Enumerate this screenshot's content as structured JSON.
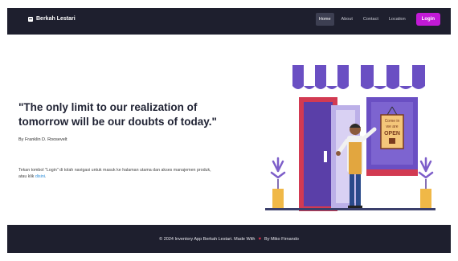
{
  "navbar": {
    "brand": "Berkah Lestari",
    "items": [
      {
        "label": "Home",
        "active": true
      },
      {
        "label": "About",
        "active": false
      },
      {
        "label": "Contact",
        "active": false
      },
      {
        "label": "Location",
        "active": false
      }
    ],
    "login_label": "Login"
  },
  "hero": {
    "quote": "\"The only limit to our realization of tomorrow will be our doubts of today.\"",
    "author": "By Franklin D. Roosevelt",
    "info_text": "Tekan tombol \"Login\" di tolah navigasi untuk masuk ke halaman utama dan akses manajemen produk, atau klik",
    "info_link": "disini",
    "info_end": ".",
    "sign_lines": [
      "Come in",
      "we are",
      "OPEN"
    ]
  },
  "footer": {
    "text_before": "© 2024 Inventory App Berkah Lestari. Made With",
    "text_after": "By Miko Firnando"
  },
  "colors": {
    "nav_bg": "#1e1f2e",
    "accent": "#c21ad6",
    "awning_purple": "#6a4fc3",
    "door_red": "#d23a52"
  }
}
